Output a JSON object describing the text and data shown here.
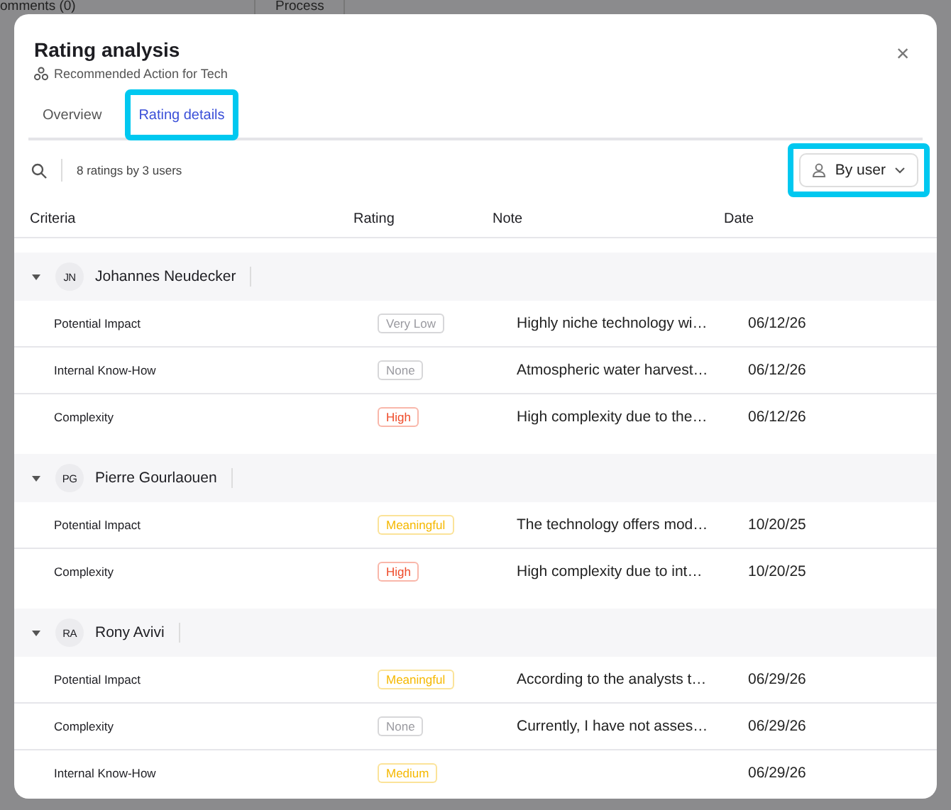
{
  "background_tabs": [
    {
      "label": "omments (0)"
    },
    {
      "label": "Process"
    }
  ],
  "dialog": {
    "title": "Rating analysis",
    "subtitle": "Recommended Action for Tech",
    "close": "×"
  },
  "tabs": [
    {
      "label": "Overview",
      "selected": false,
      "highlighted": false
    },
    {
      "label": "Rating details",
      "selected": true,
      "highlighted": true
    }
  ],
  "toolbar": {
    "summary": "8 ratings by 3 users",
    "group_by": {
      "label": "By user",
      "highlighted": true
    }
  },
  "table": {
    "columns": [
      "Criteria",
      "Rating",
      "Note",
      "Date"
    ],
    "groups": [
      {
        "initials": "JN",
        "name": "Johannes Neudecker",
        "expanded": true,
        "rows": [
          {
            "criteria": "Potential Impact",
            "rating": "Very Low",
            "color": "#9a9aa0",
            "note": "Highly niche technology wi…",
            "date": "06/12/26"
          },
          {
            "criteria": "Internal Know-How",
            "rating": "None",
            "color": "#9a9aa0",
            "note": "Atmospheric water harvest…",
            "date": "06/12/26"
          },
          {
            "criteria": "Complexity",
            "rating": "High",
            "color": "#ef4b2a",
            "note": "High complexity due to the…",
            "date": "06/12/26"
          }
        ]
      },
      {
        "initials": "PG",
        "name": "Pierre Gourlaouen",
        "expanded": true,
        "rows": [
          {
            "criteria": "Potential Impact",
            "rating": "Meaningful",
            "color": "#f5b800",
            "note": "The technology offers mod…",
            "date": "10/20/25"
          },
          {
            "criteria": "Complexity",
            "rating": "High",
            "color": "#ef4b2a",
            "note": "High complexity due to int…",
            "date": "10/20/25"
          }
        ]
      },
      {
        "initials": "RA",
        "name": "Rony Avivi",
        "expanded": true,
        "rows": [
          {
            "criteria": "Potential Impact",
            "rating": "Meaningful",
            "color": "#f5b800",
            "note": "According to the analysts t…",
            "date": "06/29/26"
          },
          {
            "criteria": "Complexity",
            "rating": "None",
            "color": "#9a9aa0",
            "note": "Currently, I have not asses…",
            "date": "06/29/26"
          },
          {
            "criteria": "Internal Know-How",
            "rating": "Medium",
            "color": "#f5b800",
            "date": "06/29/26"
          }
        ]
      }
    ]
  }
}
